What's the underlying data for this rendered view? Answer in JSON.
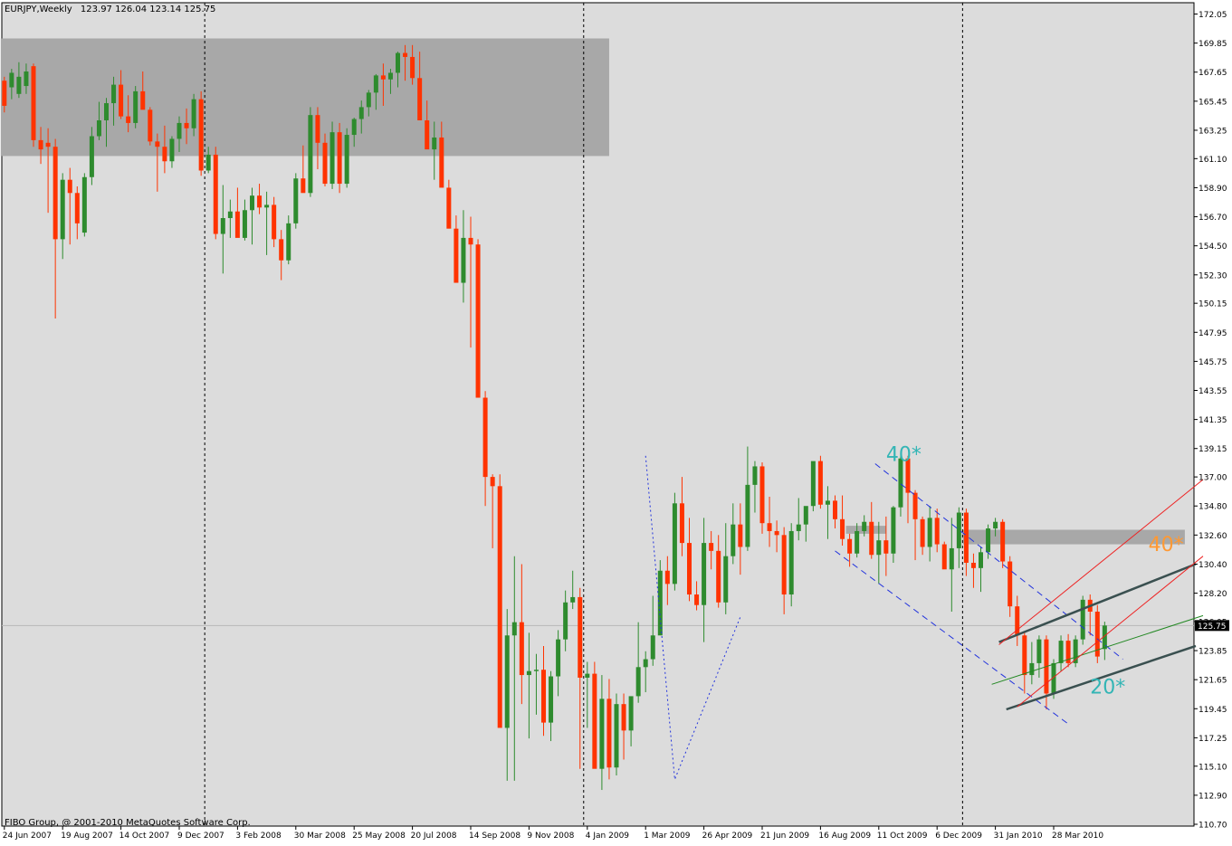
{
  "header": {
    "symbol": "EURJPY,Weekly",
    "ohlc": "123.97 126.04 123.14 125.75"
  },
  "footer": {
    "copyright": "FIBO Group, @ 2001-2010 MetaQuotes Software Corp."
  },
  "colors": {
    "background": "#dcdcdc",
    "bull": "#2e8b2e",
    "bear": "#ff3300",
    "zone": "#a8a8a8",
    "axis_text": "#000000",
    "annotation_cyan": "#33b5b5",
    "annotation_orange": "#ff9933",
    "channel_blue": "#2233dd",
    "channel_dark": "#3a5050",
    "channel_red": "#ee2222",
    "midline_green": "#228822"
  },
  "chart_data": {
    "type": "candlestick",
    "title": "EURJPY,Weekly",
    "ylim": [
      110.7,
      172.5
    ],
    "current_price": 125.75,
    "current_price_label": "125.75",
    "y_ticks": [
      "172.05",
      "169.85",
      "167.65",
      "165.45",
      "163.25",
      "161.10",
      "158.90",
      "156.70",
      "154.50",
      "152.30",
      "150.15",
      "147.95",
      "145.75",
      "143.55",
      "141.35",
      "139.15",
      "137.00",
      "134.80",
      "132.60",
      "130.40",
      "128.20",
      "126.05",
      "123.85",
      "121.65",
      "119.45",
      "117.25",
      "115.10",
      "112.90",
      "110.70"
    ],
    "x_ticks": [
      {
        "label": "24 Jun 2007",
        "bar": 0
      },
      {
        "label": "19 Aug 2007",
        "bar": 8
      },
      {
        "label": "14 Oct 2007",
        "bar": 16
      },
      {
        "label": "9 Dec 2007",
        "bar": 24
      },
      {
        "label": "3 Feb 2008",
        "bar": 32
      },
      {
        "label": "30 Mar 2008",
        "bar": 40
      },
      {
        "label": "25 May 2008",
        "bar": 48
      },
      {
        "label": "20 Jul 2008",
        "bar": 56
      },
      {
        "label": "14 Sep 2008",
        "bar": 64
      },
      {
        "label": "9 Nov 2008",
        "bar": 72
      },
      {
        "label": "4 Jan 2009",
        "bar": 80
      },
      {
        "label": "1 Mar 2009",
        "bar": 88
      },
      {
        "label": "26 Apr 2009",
        "bar": 96
      },
      {
        "label": "21 Jun 2009",
        "bar": 104
      },
      {
        "label": "16 Aug 2009",
        "bar": 112
      },
      {
        "label": "11 Oct 2009",
        "bar": 120
      },
      {
        "label": "6 Dec 2009",
        "bar": 128
      },
      {
        "label": "31 Jan 2010",
        "bar": 136
      },
      {
        "label": "28 Mar 2010",
        "bar": 144
      }
    ],
    "period_separators_bar": [
      27.5,
      79.5,
      131.5
    ],
    "resistance_zones": [
      {
        "bar_from": 0,
        "bar_to": 83,
        "low": 161.3,
        "high": 170.2
      },
      {
        "bar_from": 116,
        "bar_to": 121,
        "low": 132.7,
        "high": 133.3
      },
      {
        "bar_from": 132,
        "bar_to": 162,
        "low": 131.9,
        "high": 133.0
      }
    ],
    "annotations": [
      {
        "text": "40*",
        "bar": 121,
        "price": 138.2,
        "color": "cyan"
      },
      {
        "text": "40*",
        "bar": 157,
        "price": 131.4,
        "color": "orange"
      },
      {
        "text": "20*",
        "bar": 149,
        "price": 120.6,
        "color": "cyan"
      }
    ],
    "trendlines": [
      {
        "style": "blue-dash",
        "points": [
          [
            119.5,
            138.0
          ],
          [
            153.5,
            123.2
          ]
        ]
      },
      {
        "style": "blue-dash",
        "points": [
          [
            114,
            131.4
          ],
          [
            146,
            118.3
          ]
        ]
      },
      {
        "style": "blue-dot",
        "points": [
          [
            88,
            138.6
          ],
          [
            92,
            114.1
          ],
          [
            101,
            126.4
          ]
        ]
      },
      {
        "style": "dark",
        "points": [
          [
            136.5,
            124.5
          ],
          [
            163.5,
            130.4
          ]
        ]
      },
      {
        "style": "dark",
        "points": [
          [
            137.5,
            119.4
          ],
          [
            163.5,
            124.2
          ]
        ]
      },
      {
        "style": "green",
        "points": [
          [
            135.5,
            121.3
          ],
          [
            164.5,
            126.5
          ]
        ]
      },
      {
        "style": "red",
        "points": [
          [
            136.5,
            124.3
          ],
          [
            164.5,
            136.8
          ]
        ]
      },
      {
        "style": "red",
        "points": [
          [
            139,
            119.6
          ],
          [
            164.5,
            131.0
          ]
        ]
      }
    ],
    "candles": [
      {
        "o": 167.0,
        "h": 167.3,
        "l": 164.6,
        "c": 165.1
      },
      {
        "o": 166.5,
        "h": 167.9,
        "l": 165.6,
        "c": 167.6
      },
      {
        "o": 166.0,
        "h": 168.4,
        "l": 165.7,
        "c": 167.3
      },
      {
        "o": 166.6,
        "h": 168.3,
        "l": 166.0,
        "c": 167.7
      },
      {
        "o": 168.1,
        "h": 168.3,
        "l": 162.0,
        "c": 162.5
      },
      {
        "o": 162.5,
        "h": 163.5,
        "l": 160.7,
        "c": 161.8
      },
      {
        "o": 162.3,
        "h": 163.4,
        "l": 157.0,
        "c": 162.0
      },
      {
        "o": 162.0,
        "h": 162.6,
        "l": 149.0,
        "c": 155.0
      },
      {
        "o": 155.0,
        "h": 160.0,
        "l": 153.5,
        "c": 159.5
      },
      {
        "o": 159.5,
        "h": 160.4,
        "l": 154.6,
        "c": 158.5
      },
      {
        "o": 158.5,
        "h": 159.0,
        "l": 155.0,
        "c": 156.2
      },
      {
        "o": 155.5,
        "h": 160.0,
        "l": 155.2,
        "c": 159.7
      },
      {
        "o": 159.7,
        "h": 163.5,
        "l": 159.1,
        "c": 162.8
      },
      {
        "o": 162.8,
        "h": 165.4,
        "l": 162.5,
        "c": 164.0
      },
      {
        "o": 164.0,
        "h": 165.7,
        "l": 162.0,
        "c": 165.3
      },
      {
        "o": 165.3,
        "h": 167.3,
        "l": 163.6,
        "c": 166.7
      },
      {
        "o": 166.7,
        "h": 167.8,
        "l": 164.1,
        "c": 164.3
      },
      {
        "o": 164.3,
        "h": 165.9,
        "l": 163.1,
        "c": 163.8
      },
      {
        "o": 163.8,
        "h": 166.6,
        "l": 163.4,
        "c": 166.2
      },
      {
        "o": 166.2,
        "h": 167.7,
        "l": 165.0,
        "c": 164.8
      },
      {
        "o": 164.8,
        "h": 165.0,
        "l": 162.1,
        "c": 162.4
      },
      {
        "o": 162.4,
        "h": 163.0,
        "l": 158.6,
        "c": 162.0
      },
      {
        "o": 162.0,
        "h": 163.6,
        "l": 160.0,
        "c": 160.9
      },
      {
        "o": 160.9,
        "h": 162.8,
        "l": 160.4,
        "c": 162.6
      },
      {
        "o": 162.6,
        "h": 164.3,
        "l": 161.6,
        "c": 163.8
      },
      {
        "o": 163.8,
        "h": 164.9,
        "l": 162.2,
        "c": 163.4
      },
      {
        "o": 163.4,
        "h": 166.0,
        "l": 162.8,
        "c": 165.6
      },
      {
        "o": 165.6,
        "h": 166.2,
        "l": 159.8,
        "c": 160.2
      },
      {
        "o": 160.2,
        "h": 162.0,
        "l": 160.0,
        "c": 161.4
      },
      {
        "o": 161.4,
        "h": 162.0,
        "l": 155.0,
        "c": 155.4
      },
      {
        "o": 155.4,
        "h": 159.1,
        "l": 152.4,
        "c": 156.6
      },
      {
        "o": 156.6,
        "h": 158.0,
        "l": 155.1,
        "c": 157.1
      },
      {
        "o": 157.1,
        "h": 158.9,
        "l": 155.5,
        "c": 155.1
      },
      {
        "o": 155.1,
        "h": 158.0,
        "l": 154.9,
        "c": 157.2
      },
      {
        "o": 157.2,
        "h": 158.9,
        "l": 154.6,
        "c": 158.3
      },
      {
        "o": 158.3,
        "h": 159.2,
        "l": 156.9,
        "c": 157.4
      },
      {
        "o": 157.4,
        "h": 158.6,
        "l": 153.8,
        "c": 157.6
      },
      {
        "o": 157.6,
        "h": 158.2,
        "l": 154.4,
        "c": 155.0
      },
      {
        "o": 155.0,
        "h": 155.7,
        "l": 151.9,
        "c": 153.4
      },
      {
        "o": 153.4,
        "h": 156.8,
        "l": 153.1,
        "c": 156.2
      },
      {
        "o": 156.2,
        "h": 160.0,
        "l": 155.8,
        "c": 159.6
      },
      {
        "o": 159.6,
        "h": 162.1,
        "l": 158.9,
        "c": 158.5
      },
      {
        "o": 158.5,
        "h": 165.0,
        "l": 158.2,
        "c": 164.4
      },
      {
        "o": 164.4,
        "h": 165.0,
        "l": 160.3,
        "c": 162.3
      },
      {
        "o": 162.3,
        "h": 163.0,
        "l": 159.0,
        "c": 159.2
      },
      {
        "o": 159.2,
        "h": 163.9,
        "l": 158.8,
        "c": 163.1
      },
      {
        "o": 163.1,
        "h": 163.8,
        "l": 158.5,
        "c": 159.2
      },
      {
        "o": 159.2,
        "h": 163.4,
        "l": 158.9,
        "c": 162.9
      },
      {
        "o": 162.9,
        "h": 164.2,
        "l": 162.0,
        "c": 164.1
      },
      {
        "o": 164.1,
        "h": 165.5,
        "l": 163.0,
        "c": 165.0
      },
      {
        "o": 165.0,
        "h": 166.3,
        "l": 164.3,
        "c": 166.1
      },
      {
        "o": 166.1,
        "h": 167.5,
        "l": 164.8,
        "c": 167.4
      },
      {
        "o": 167.4,
        "h": 168.3,
        "l": 165.1,
        "c": 167.1
      },
      {
        "o": 167.1,
        "h": 167.9,
        "l": 166.0,
        "c": 167.6
      },
      {
        "o": 167.6,
        "h": 169.2,
        "l": 166.5,
        "c": 169.1
      },
      {
        "o": 169.1,
        "h": 169.7,
        "l": 167.0,
        "c": 168.8
      },
      {
        "o": 168.8,
        "h": 169.7,
        "l": 166.7,
        "c": 167.2
      },
      {
        "o": 167.2,
        "h": 169.2,
        "l": 166.0,
        "c": 164.0
      },
      {
        "o": 164.0,
        "h": 165.5,
        "l": 163.2,
        "c": 161.8
      },
      {
        "o": 161.8,
        "h": 163.9,
        "l": 159.5,
        "c": 162.7
      },
      {
        "o": 162.7,
        "h": 163.9,
        "l": 159.0,
        "c": 158.9
      },
      {
        "o": 158.9,
        "h": 159.5,
        "l": 156.4,
        "c": 155.8
      },
      {
        "o": 155.8,
        "h": 156.8,
        "l": 152.1,
        "c": 151.7
      },
      {
        "o": 151.7,
        "h": 157.2,
        "l": 150.2,
        "c": 155.1
      },
      {
        "o": 155.1,
        "h": 156.7,
        "l": 146.8,
        "c": 154.6
      },
      {
        "o": 154.6,
        "h": 155.0,
        "l": 145.5,
        "c": 143.0
      },
      {
        "o": 143.0,
        "h": 143.5,
        "l": 134.8,
        "c": 137.0
      },
      {
        "o": 137.0,
        "h": 137.2,
        "l": 131.6,
        "c": 136.3
      },
      {
        "o": 136.3,
        "h": 137.2,
        "l": 128.0,
        "c": 118.0
      },
      {
        "o": 118.0,
        "h": 127.0,
        "l": 114.0,
        "c": 125.0
      },
      {
        "o": 125.0,
        "h": 131.0,
        "l": 114.0,
        "c": 126.0
      },
      {
        "o": 126.0,
        "h": 130.4,
        "l": 119.8,
        "c": 122.0
      },
      {
        "o": 122.0,
        "h": 125.2,
        "l": 117.2,
        "c": 122.3
      },
      {
        "o": 122.3,
        "h": 123.6,
        "l": 119.0,
        "c": 122.4
      },
      {
        "o": 122.4,
        "h": 124.2,
        "l": 117.4,
        "c": 118.4
      },
      {
        "o": 118.4,
        "h": 122.3,
        "l": 117.0,
        "c": 121.9
      },
      {
        "o": 121.9,
        "h": 125.4,
        "l": 120.4,
        "c": 124.7
      },
      {
        "o": 124.7,
        "h": 128.4,
        "l": 123.8,
        "c": 127.5
      },
      {
        "o": 127.5,
        "h": 129.9,
        "l": 127.0,
        "c": 127.9
      },
      {
        "o": 127.9,
        "h": 128.6,
        "l": 114.9,
        "c": 121.8
      },
      {
        "o": 121.8,
        "h": 123.0,
        "l": 118.0,
        "c": 122.1
      },
      {
        "o": 122.1,
        "h": 123.0,
        "l": 116.6,
        "c": 114.9
      },
      {
        "o": 114.9,
        "h": 122.0,
        "l": 113.3,
        "c": 120.2
      },
      {
        "o": 120.2,
        "h": 121.7,
        "l": 114.1,
        "c": 115.0
      },
      {
        "o": 115.0,
        "h": 120.6,
        "l": 114.4,
        "c": 119.8
      },
      {
        "o": 119.8,
        "h": 120.6,
        "l": 115.6,
        "c": 117.8
      },
      {
        "o": 117.8,
        "h": 120.1,
        "l": 116.6,
        "c": 120.4
      },
      {
        "o": 120.4,
        "h": 126.0,
        "l": 119.9,
        "c": 122.6
      },
      {
        "o": 122.6,
        "h": 123.8,
        "l": 120.7,
        "c": 123.2
      },
      {
        "o": 123.2,
        "h": 128.0,
        "l": 122.7,
        "c": 125.0
      },
      {
        "o": 125.0,
        "h": 130.7,
        "l": 125.4,
        "c": 129.9
      },
      {
        "o": 129.9,
        "h": 131.0,
        "l": 127.3,
        "c": 128.9
      },
      {
        "o": 128.9,
        "h": 135.8,
        "l": 128.4,
        "c": 135.0
      },
      {
        "o": 135.0,
        "h": 137.0,
        "l": 131.0,
        "c": 132.0
      },
      {
        "o": 132.0,
        "h": 133.9,
        "l": 127.6,
        "c": 128.1
      },
      {
        "o": 128.1,
        "h": 129.1,
        "l": 126.9,
        "c": 127.3
      },
      {
        "o": 127.3,
        "h": 133.9,
        "l": 124.5,
        "c": 132.0
      },
      {
        "o": 132.0,
        "h": 132.9,
        "l": 130.0,
        "c": 131.4
      },
      {
        "o": 131.4,
        "h": 132.6,
        "l": 127.1,
        "c": 127.5
      },
      {
        "o": 127.5,
        "h": 133.5,
        "l": 126.6,
        "c": 131.0
      },
      {
        "o": 131.0,
        "h": 135.0,
        "l": 130.4,
        "c": 133.4
      },
      {
        "o": 133.4,
        "h": 135.0,
        "l": 129.6,
        "c": 131.7
      },
      {
        "o": 131.7,
        "h": 139.3,
        "l": 131.4,
        "c": 136.4
      },
      {
        "o": 136.4,
        "h": 138.2,
        "l": 134.3,
        "c": 137.8
      },
      {
        "o": 137.8,
        "h": 138.1,
        "l": 132.7,
        "c": 133.5
      },
      {
        "o": 133.5,
        "h": 135.5,
        "l": 131.7,
        "c": 132.9
      },
      {
        "o": 132.9,
        "h": 133.7,
        "l": 131.3,
        "c": 132.6
      },
      {
        "o": 132.6,
        "h": 133.2,
        "l": 126.6,
        "c": 128.1
      },
      {
        "o": 128.1,
        "h": 133.5,
        "l": 127.2,
        "c": 132.9
      },
      {
        "o": 132.9,
        "h": 135.4,
        "l": 132.2,
        "c": 133.4
      },
      {
        "o": 133.4,
        "h": 134.4,
        "l": 132.1,
        "c": 134.8
      },
      {
        "o": 134.8,
        "h": 137.6,
        "l": 134.4,
        "c": 138.2
      },
      {
        "o": 138.2,
        "h": 138.6,
        "l": 134.6,
        "c": 134.9
      },
      {
        "o": 134.9,
        "h": 136.3,
        "l": 132.3,
        "c": 135.2
      },
      {
        "o": 135.2,
        "h": 135.6,
        "l": 133.1,
        "c": 133.8
      },
      {
        "o": 133.8,
        "h": 135.6,
        "l": 131.8,
        "c": 132.3
      },
      {
        "o": 132.3,
        "h": 132.7,
        "l": 130.2,
        "c": 131.2
      },
      {
        "o": 131.2,
        "h": 133.5,
        "l": 130.9,
        "c": 132.9
      },
      {
        "o": 132.9,
        "h": 134.1,
        "l": 132.5,
        "c": 133.6
      },
      {
        "o": 133.6,
        "h": 135.1,
        "l": 130.8,
        "c": 131.1
      },
      {
        "o": 131.1,
        "h": 133.6,
        "l": 128.9,
        "c": 132.2
      },
      {
        "o": 132.2,
        "h": 134.0,
        "l": 129.5,
        "c": 131.2
      },
      {
        "o": 131.2,
        "h": 134.8,
        "l": 130.5,
        "c": 134.7
      },
      {
        "o": 134.7,
        "h": 138.7,
        "l": 134.0,
        "c": 138.4
      },
      {
        "o": 138.4,
        "h": 138.6,
        "l": 133.5,
        "c": 135.8
      },
      {
        "o": 135.8,
        "h": 136.0,
        "l": 130.7,
        "c": 133.8
      },
      {
        "o": 133.8,
        "h": 134.0,
        "l": 131.1,
        "c": 131.7
      },
      {
        "o": 131.7,
        "h": 134.8,
        "l": 130.6,
        "c": 133.9
      },
      {
        "o": 133.9,
        "h": 134.6,
        "l": 131.3,
        "c": 131.9
      },
      {
        "o": 131.9,
        "h": 132.1,
        "l": 130.2,
        "c": 130.0
      },
      {
        "o": 130.0,
        "h": 133.9,
        "l": 126.8,
        "c": 131.6
      },
      {
        "o": 131.6,
        "h": 134.7,
        "l": 130.1,
        "c": 134.3
      },
      {
        "o": 134.3,
        "h": 134.6,
        "l": 129.5,
        "c": 130.5
      },
      {
        "o": 130.5,
        "h": 131.2,
        "l": 128.6,
        "c": 130.1
      },
      {
        "o": 130.1,
        "h": 131.7,
        "l": 128.3,
        "c": 131.3
      },
      {
        "o": 131.3,
        "h": 133.4,
        "l": 130.8,
        "c": 133.1
      },
      {
        "o": 133.1,
        "h": 133.9,
        "l": 132.5,
        "c": 133.6
      },
      {
        "o": 133.6,
        "h": 133.8,
        "l": 130.1,
        "c": 130.6
      },
      {
        "o": 130.6,
        "h": 131.0,
        "l": 126.4,
        "c": 127.2
      },
      {
        "o": 127.2,
        "h": 128.0,
        "l": 124.2,
        "c": 125.0
      },
      {
        "o": 125.0,
        "h": 125.3,
        "l": 120.6,
        "c": 122.0
      },
      {
        "o": 122.0,
        "h": 124.5,
        "l": 121.3,
        "c": 122.9
      },
      {
        "o": 122.9,
        "h": 125.0,
        "l": 121.8,
        "c": 124.7
      },
      {
        "o": 124.7,
        "h": 125.0,
        "l": 119.4,
        "c": 120.6
      },
      {
        "o": 120.6,
        "h": 123.2,
        "l": 120.2,
        "c": 122.9
      },
      {
        "o": 122.9,
        "h": 125.0,
        "l": 122.3,
        "c": 124.6
      },
      {
        "o": 124.6,
        "h": 125.1,
        "l": 122.6,
        "c": 122.9
      },
      {
        "o": 122.9,
        "h": 125.0,
        "l": 122.6,
        "c": 124.7
      },
      {
        "o": 124.7,
        "h": 128.0,
        "l": 124.3,
        "c": 127.7
      },
      {
        "o": 127.7,
        "h": 128.1,
        "l": 125.0,
        "c": 126.8
      },
      {
        "o": 126.8,
        "h": 127.3,
        "l": 122.9,
        "c": 123.4
      },
      {
        "o": 123.97,
        "h": 126.04,
        "l": 123.14,
        "c": 125.75
      }
    ]
  }
}
